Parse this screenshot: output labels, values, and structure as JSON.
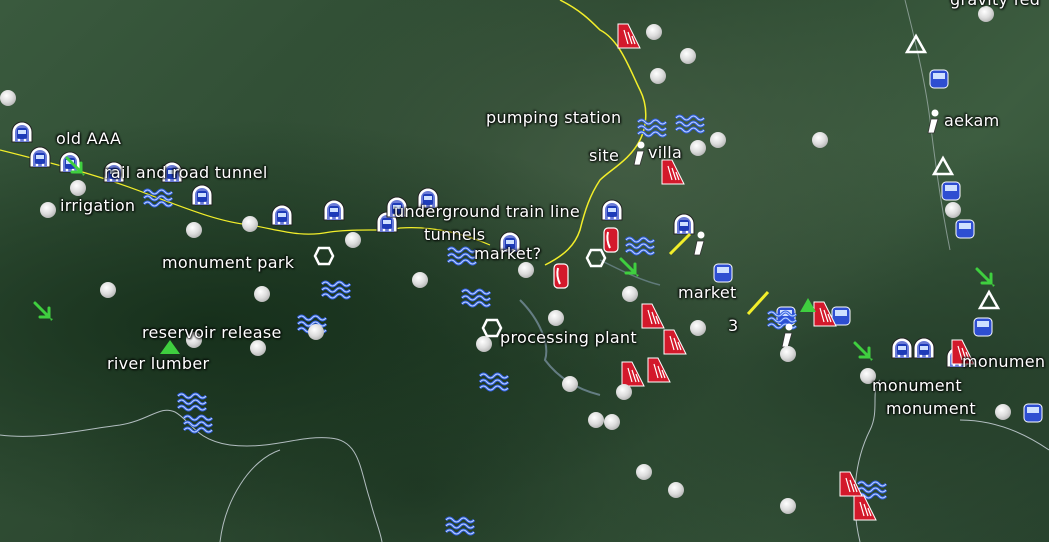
{
  "labels": {
    "old_aaa": "old AAA",
    "rail_and_road_tunnel": "rail and road tunnel",
    "irrigation": "irrigation",
    "monument_park": "monument park",
    "reservoir_release": "reservoir release",
    "river_lumber": "river lumber",
    "underground_train_line": "underground train line",
    "tunnels": "tunnels",
    "market_question": "market?",
    "processing_plant": "processing plant",
    "pumping_station": "pumping station",
    "site": "site",
    "villa": "villa",
    "market": "market",
    "three": "3",
    "aekam": "aekam",
    "monument_1": "monument",
    "monument_2": "monument",
    "monument_right": "monumen",
    "gravity_fed": "gravity fed"
  },
  "icons": {
    "train": "train-tunnel-icon",
    "water": "water-waves-icon",
    "waterfall": "waterfall-icon",
    "info": "info-icon",
    "phone": "phone-icon",
    "arrow": "down-right-arrow-icon",
    "triangle": "triangle-marker-icon",
    "hexagon": "hexagon-marker-icon",
    "dot": "placemark-dot-icon"
  },
  "colors": {
    "border_line": "#f2ee2a",
    "river_line": "#8fa7c0",
    "boundary_line": "#d6dde6",
    "train_blue": "#2e4ed1",
    "water_blue": "#2f5fe0",
    "waterfall_red": "#d3192b",
    "arrow_green": "#3fcf3f"
  }
}
